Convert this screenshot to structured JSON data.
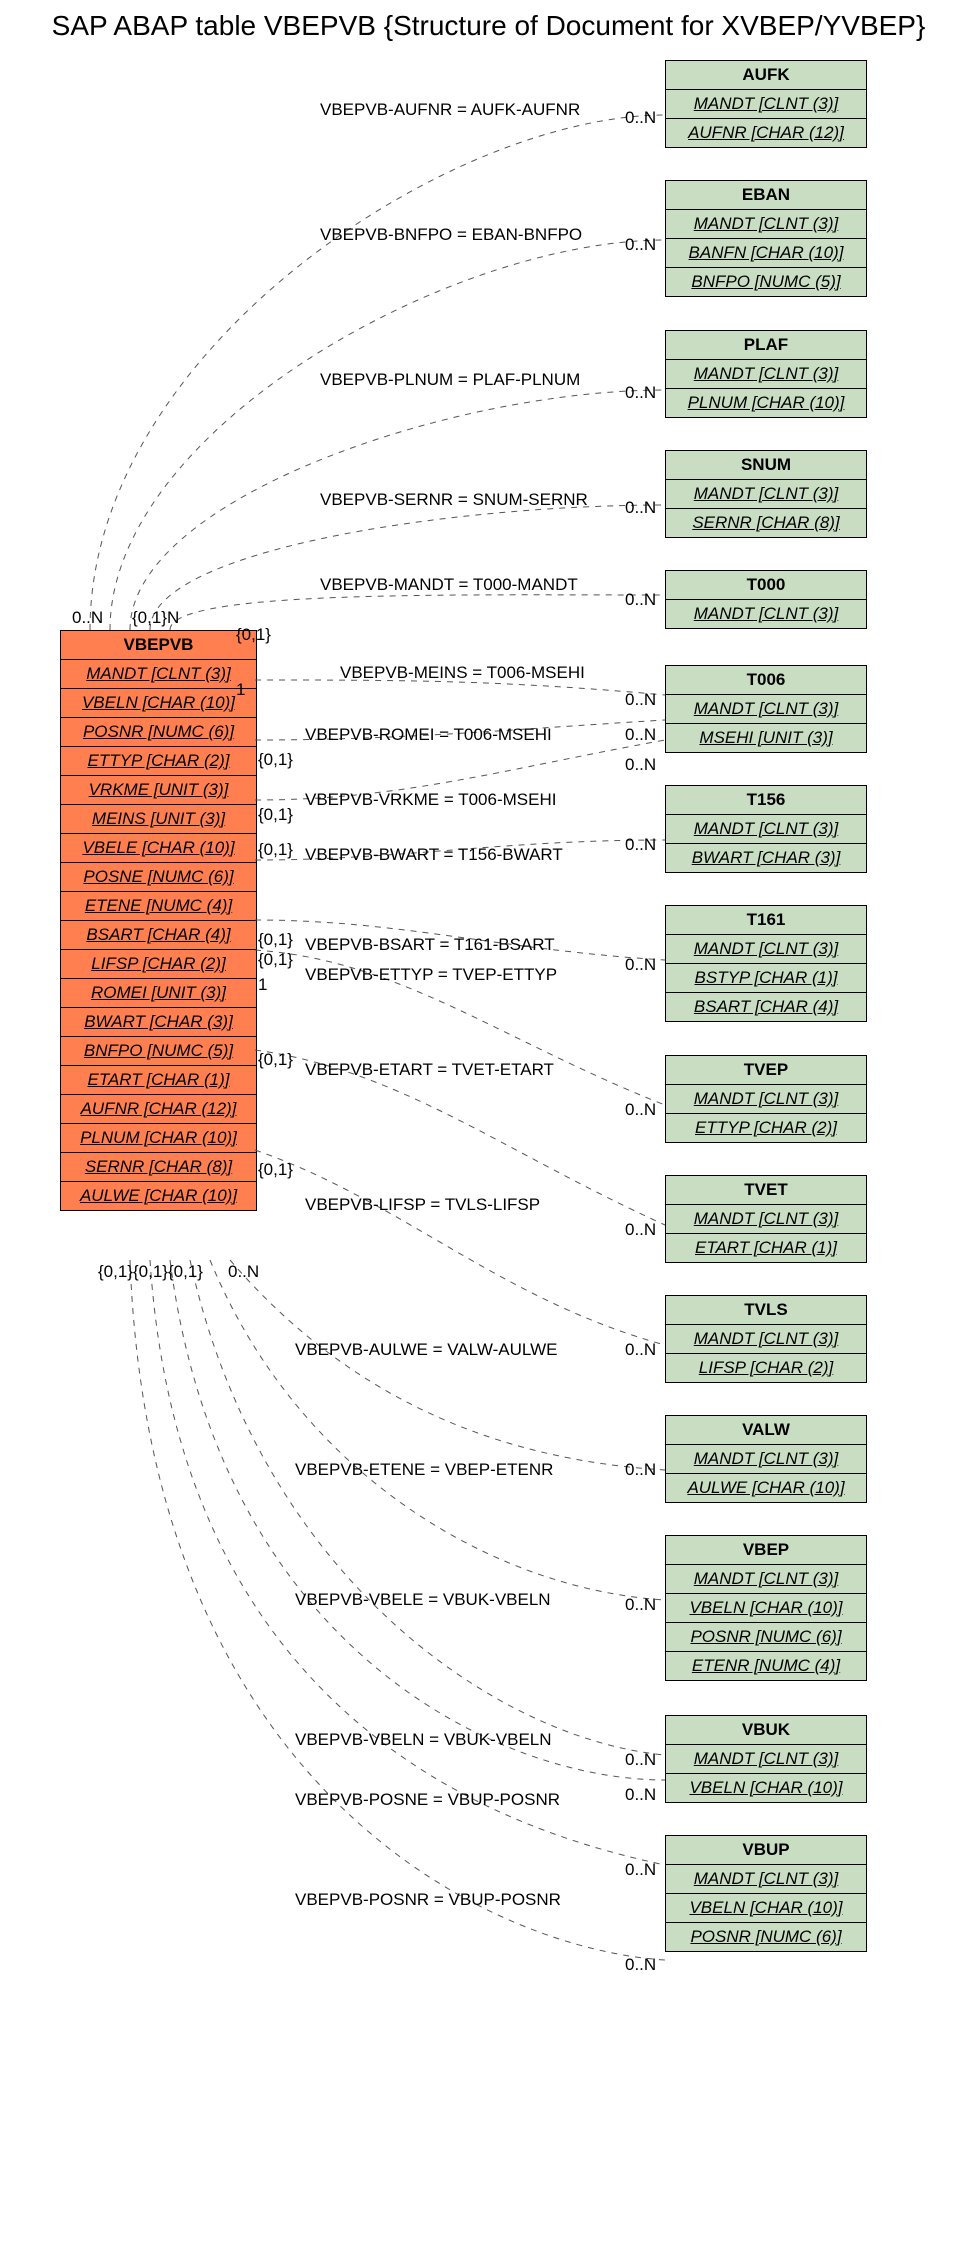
{
  "title": "SAP ABAP table VBEPVB {Structure of Document for XVBEP/YVBEP}",
  "main": {
    "name": "VBEPVB",
    "fields": [
      "MANDT [CLNT (3)]",
      "VBELN [CHAR (10)]",
      "POSNR [NUMC (6)]",
      "ETTYP [CHAR (2)]",
      "VRKME [UNIT (3)]",
      "MEINS [UNIT (3)]",
      "VBELE [CHAR (10)]",
      "POSNE [NUMC (6)]",
      "ETENE [NUMC (4)]",
      "BSART [CHAR (4)]",
      "LIFSP [CHAR (2)]",
      "ROMEI [UNIT (3)]",
      "BWART [CHAR (3)]",
      "BNFPO [NUMC (5)]",
      "ETART [CHAR (1)]",
      "AUFNR [CHAR (12)]",
      "PLNUM [CHAR (10)]",
      "SERNR [CHAR (8)]",
      "AULWE [CHAR (10)]"
    ]
  },
  "refs": [
    {
      "name": "AUFK",
      "fields": [
        "MANDT [CLNT (3)]",
        "AUFNR [CHAR (12)]"
      ]
    },
    {
      "name": "EBAN",
      "fields": [
        "MANDT [CLNT (3)]",
        "BANFN [CHAR (10)]",
        "BNFPO [NUMC (5)]"
      ]
    },
    {
      "name": "PLAF",
      "fields": [
        "MANDT [CLNT (3)]",
        "PLNUM [CHAR (10)]"
      ]
    },
    {
      "name": "SNUM",
      "fields": [
        "MANDT [CLNT (3)]",
        "SERNR [CHAR (8)]"
      ]
    },
    {
      "name": "T000",
      "fields": [
        "MANDT [CLNT (3)]"
      ]
    },
    {
      "name": "T006",
      "fields": [
        "MANDT [CLNT (3)]",
        "MSEHI [UNIT (3)]"
      ]
    },
    {
      "name": "T156",
      "fields": [
        "MANDT [CLNT (3)]",
        "BWART [CHAR (3)]"
      ]
    },
    {
      "name": "T161",
      "fields": [
        "MANDT [CLNT (3)]",
        "BSTYP [CHAR (1)]",
        "BSART [CHAR (4)]"
      ]
    },
    {
      "name": "TVEP",
      "fields": [
        "MANDT [CLNT (3)]",
        "ETTYP [CHAR (2)]"
      ]
    },
    {
      "name": "TVET",
      "fields": [
        "MANDT [CLNT (3)]",
        "ETART [CHAR (1)]"
      ]
    },
    {
      "name": "TVLS",
      "fields": [
        "MANDT [CLNT (3)]",
        "LIFSP [CHAR (2)]"
      ]
    },
    {
      "name": "VALW",
      "fields": [
        "MANDT [CLNT (3)]",
        "AULWE [CHAR (10)]"
      ]
    },
    {
      "name": "VBEP",
      "fields": [
        "MANDT [CLNT (3)]",
        "VBELN [CHAR (10)]",
        "POSNR [NUMC (6)]",
        "ETENR [NUMC (4)]"
      ]
    },
    {
      "name": "VBUK",
      "fields": [
        "MANDT [CLNT (3)]",
        "VBELN [CHAR (10)]"
      ]
    },
    {
      "name": "VBUP",
      "fields": [
        "MANDT [CLNT (3)]",
        "VBELN [CHAR (10)]",
        "POSNR [NUMC (6)]"
      ]
    }
  ],
  "edges": [
    {
      "label": "VBEPVB-AUFNR = AUFK-AUFNR"
    },
    {
      "label": "VBEPVB-BNFPO = EBAN-BNFPO"
    },
    {
      "label": "VBEPVB-PLNUM = PLAF-PLNUM"
    },
    {
      "label": "VBEPVB-SERNR = SNUM-SERNR"
    },
    {
      "label": "VBEPVB-MANDT = T000-MANDT"
    },
    {
      "label": "VBEPVB-MEINS = T006-MSEHI"
    },
    {
      "label": "VBEPVB-ROMEI = T006-MSEHI"
    },
    {
      "label": "VBEPVB-VRKME = T006-MSEHI"
    },
    {
      "label": "VBEPVB-BWART = T156-BWART"
    },
    {
      "label": "VBEPVB-BSART = T161-BSART"
    },
    {
      "label": "VBEPVB-ETTYP = TVEP-ETTYP"
    },
    {
      "label": "VBEPVB-ETART = TVET-ETART"
    },
    {
      "label": "VBEPVB-LIFSP = TVLS-LIFSP"
    },
    {
      "label": "VBEPVB-AULWE = VALW-AULWE"
    },
    {
      "label": "VBEPVB-ETENE = VBEP-ETENR"
    },
    {
      "label": "VBEPVB-VBELE = VBUK-VBELN"
    },
    {
      "label": "VBEPVB-VBELN = VBUK-VBELN"
    },
    {
      "label": "VBEPVB-POSNE = VBUP-POSNR"
    },
    {
      "label": "VBEPVB-POSNR = VBUP-POSNR"
    }
  ],
  "cards_top": [
    "0..N",
    "{0,1}N",
    "{0,1}",
    "1"
  ],
  "cards_mid": [
    "{0,1}",
    "{0,1}",
    "{0,1}",
    "{0,1}",
    "{0,1}",
    "1",
    "{0,1}",
    "{0,1}"
  ],
  "cards_bot": [
    "{0,1}{0,1}{0,1}",
    "0..N"
  ],
  "card_right": "0..N",
  "colors": {
    "main": "#ff7f50",
    "ref": "#c8ddc2"
  }
}
